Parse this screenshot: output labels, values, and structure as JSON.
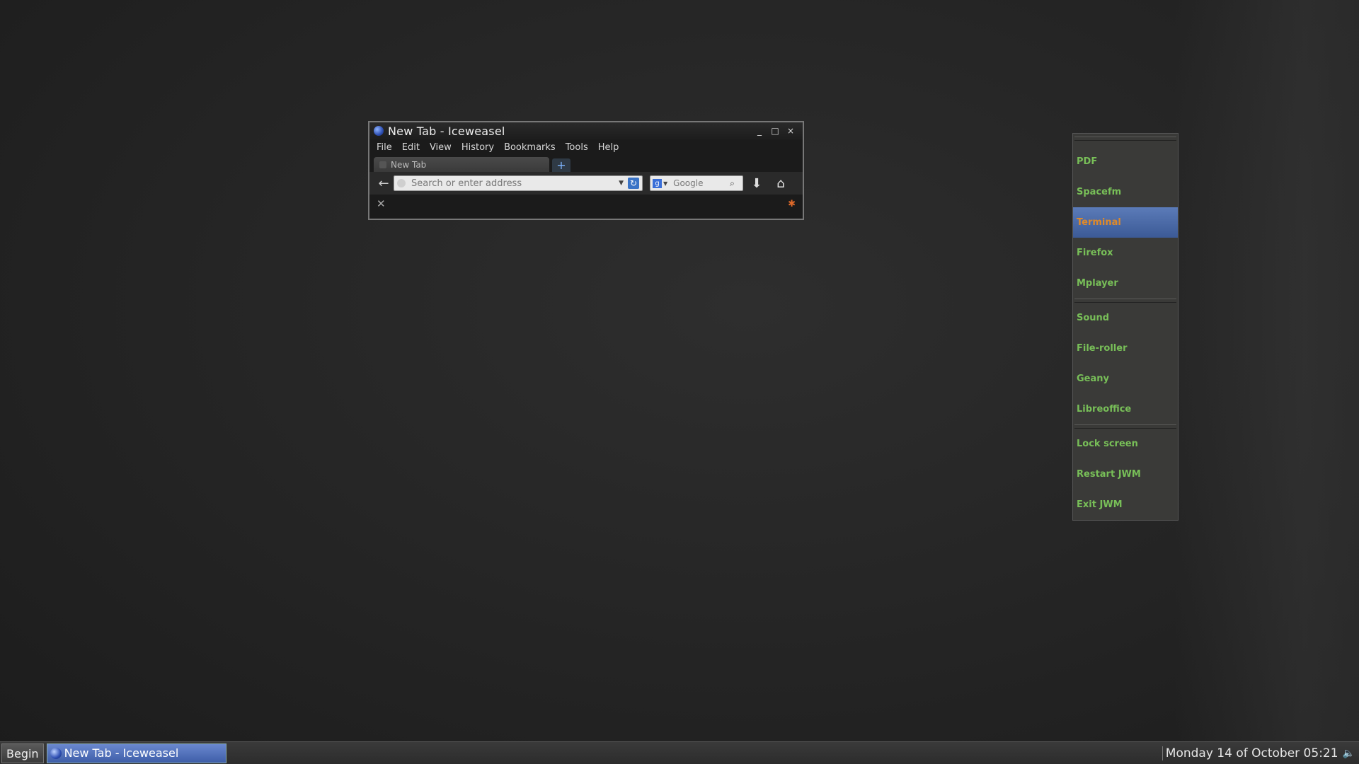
{
  "window": {
    "title": "New Tab - Iceweasel",
    "controls": {
      "minimize": "_",
      "maximize": "□",
      "close": "×"
    },
    "menu": [
      "File",
      "Edit",
      "View",
      "History",
      "Bookmarks",
      "Tools",
      "Help"
    ],
    "tab": {
      "label": "New Tab",
      "new_tab": "+"
    },
    "nav": {
      "back": "←",
      "url_placeholder": "Search or enter address",
      "url_value": "",
      "search_engine_letter": "g",
      "search_placeholder": "Google",
      "download": "⬇",
      "home": "⌂"
    },
    "notification": {
      "close": "✕",
      "addon": "✱"
    }
  },
  "rootmenu": {
    "groups": [
      [
        "PDF",
        "Spacefm",
        "Terminal",
        "Firefox",
        "Mplayer"
      ],
      [
        "Sound",
        "File-roller",
        "Geany",
        "Libreoffice"
      ],
      [
        "Lock screen",
        "Restart JWM",
        "Exit JWM"
      ]
    ],
    "active": "Terminal"
  },
  "taskbar": {
    "begin": "Begin",
    "task": "New Tab - Iceweasel",
    "clock": "Monday 14 of October 05:21",
    "volume": "🔈"
  },
  "colors": {
    "menu_text": "#78bf58",
    "menu_active_bg": "#4a6aa8",
    "menu_active_text": "#e08a2a",
    "task_active": "#4e6eb8"
  }
}
